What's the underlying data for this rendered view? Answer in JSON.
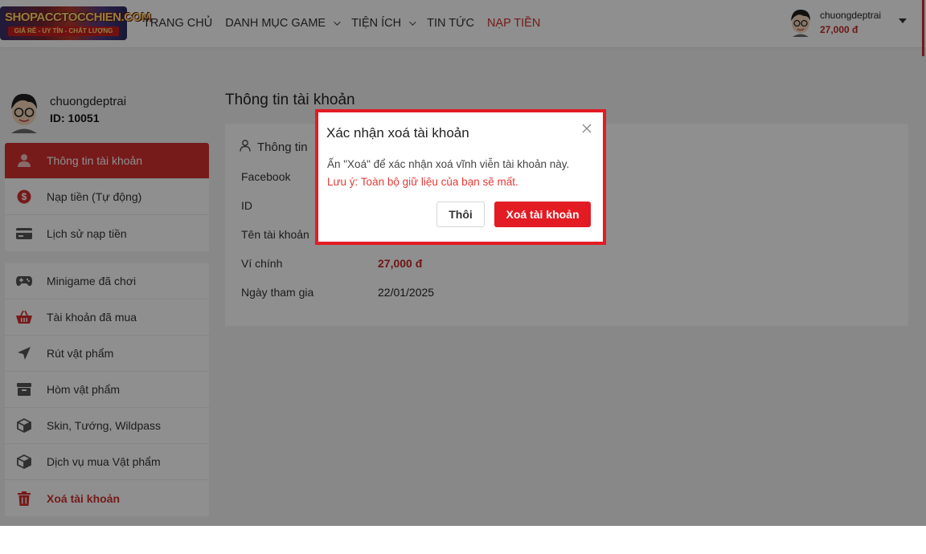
{
  "header": {
    "logo_text": "SHOPACCTOCCHIEN.COM",
    "logo_tagline": "GIÁ RẺ - UY TÍN - CHẤT LƯỢNG",
    "nav": [
      {
        "label": "TRANG CHỦ",
        "has_dropdown": false
      },
      {
        "label": "DANH MỤC GAME",
        "has_dropdown": true
      },
      {
        "label": "TIỆN ÍCH",
        "has_dropdown": true
      },
      {
        "label": "TIN TỨC",
        "has_dropdown": false
      },
      {
        "label": "NẠP TIỀN",
        "has_dropdown": false
      }
    ],
    "user": {
      "name": "chuongdeptrai",
      "balance": "27,000 đ"
    }
  },
  "sidebar": {
    "profile": {
      "name": "chuongdeptrai",
      "id_label": "ID: 10051"
    },
    "group1": [
      {
        "label": "Thông tin tài khoản",
        "icon": "user-icon"
      },
      {
        "label": "Nạp tiền (Tự động)",
        "icon": "dollar-circle-icon"
      },
      {
        "label": "Lịch sử nạp tiền",
        "icon": "credit-card-icon"
      }
    ],
    "group2": [
      {
        "label": "Minigame đã chơi",
        "icon": "gamepad-icon"
      },
      {
        "label": "Tài khoản đã mua",
        "icon": "basket-icon"
      },
      {
        "label": "Rút vật phẩm",
        "icon": "send-icon"
      },
      {
        "label": "Hòm vật phẩm",
        "icon": "archive-icon"
      },
      {
        "label": "Skin, Tướng, Wildpass",
        "icon": "cube-icon"
      },
      {
        "label": "Dịch vụ mua Vật phẩm",
        "icon": "cube-icon"
      },
      {
        "label": "Xoá tài khoản",
        "icon": "trash-icon"
      }
    ]
  },
  "main": {
    "title": "Thông tin tài khoản",
    "card_title": "Thông tin",
    "rows": [
      {
        "label": "Facebook",
        "value": ""
      },
      {
        "label": "ID",
        "value": ""
      },
      {
        "label": "Tên tài khoản",
        "value": ""
      },
      {
        "label": "Ví chính",
        "value": "27,000 đ"
      },
      {
        "label": "Ngày tham gia",
        "value": "22/01/2025"
      }
    ]
  },
  "modal": {
    "title": "Xác nhận xoá tài khoản",
    "message": "Ấn \"Xoá\" để xác nhận xoá vĩnh viễn tài khoản này.",
    "warning": "Lưu ý: Toàn bộ giữ liệu của bạn sẽ mất.",
    "cancel_label": "Thôi",
    "confirm_label": "Xoá tài khoản"
  },
  "colors": {
    "accent": "#d32f2f",
    "danger_button": "#e31b23",
    "warning_text": "#e53935",
    "overlay": "rgba(0,0,0,0.44)"
  }
}
